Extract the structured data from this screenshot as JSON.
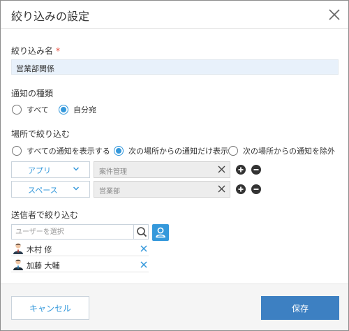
{
  "dialog": {
    "title": "絞り込みの設定"
  },
  "filter_name": {
    "label": "絞り込み名",
    "required_mark": "*",
    "value": "営業部関係"
  },
  "notification_type": {
    "label": "通知の種類",
    "options": [
      {
        "label": "すべて",
        "selected": false
      },
      {
        "label": "自分宛",
        "selected": true
      }
    ]
  },
  "location_filter": {
    "label": "場所で絞り込む",
    "options": [
      {
        "label": "すべての通知を表示する",
        "selected": false
      },
      {
        "label": "次の場所からの通知だけ表示",
        "selected": true
      },
      {
        "label": "次の場所からの通知を除外",
        "selected": false
      }
    ],
    "rows": [
      {
        "type": "アプリ",
        "value": "案件管理"
      },
      {
        "type": "スペース",
        "value": "営業部"
      }
    ]
  },
  "sender_filter": {
    "label": "送信者で絞り込む",
    "search_placeholder": "ユーザーを選択",
    "users": [
      {
        "name": "木村 修"
      },
      {
        "name": "加藤 大輔"
      }
    ]
  },
  "footer": {
    "cancel_label": "キャンセル",
    "save_label": "保存"
  },
  "colors": {
    "accent": "#3498db",
    "primary_button": "#3d80c2",
    "required": "#e74c3c",
    "input_bg": "#e8f1fb"
  },
  "icons": [
    "close-icon",
    "chevron-down-icon",
    "clear-icon",
    "plus-circle-icon",
    "minus-circle-icon",
    "search-icon",
    "user-icon",
    "avatar-icon"
  ]
}
